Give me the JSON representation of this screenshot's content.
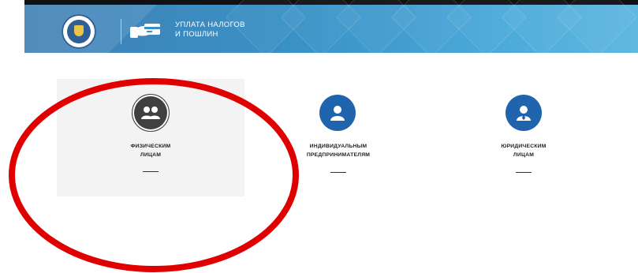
{
  "header": {
    "title_line1": "УПЛАТА НАЛОГОВ",
    "title_line2": "И ПОШЛИН",
    "logo_icon": "fns-emblem-icon",
    "service_icon": "card-payment-icon"
  },
  "categories": [
    {
      "icon": "people-group-icon",
      "line1": "ФИЗИЧЕСКИМ",
      "line2": "ЛИЦАМ",
      "selected": true
    },
    {
      "icon": "person-icon",
      "line1": "ИНДИВИДУАЛЬНЫМ",
      "line2": "ПРЕДПРИНИМАТЕЛЯМ",
      "selected": false
    },
    {
      "icon": "businessman-icon",
      "line1": "ЮРИДИЧЕСКИМ",
      "line2": "ЛИЦАМ",
      "selected": false
    }
  ],
  "colors": {
    "header_start": "#3f7fb4",
    "header_end": "#5fb8e0",
    "icon_blue": "#1f64ad",
    "icon_dark": "#404040",
    "annotation_red": "#e00000",
    "selected_bg": "#f3f3f3"
  }
}
